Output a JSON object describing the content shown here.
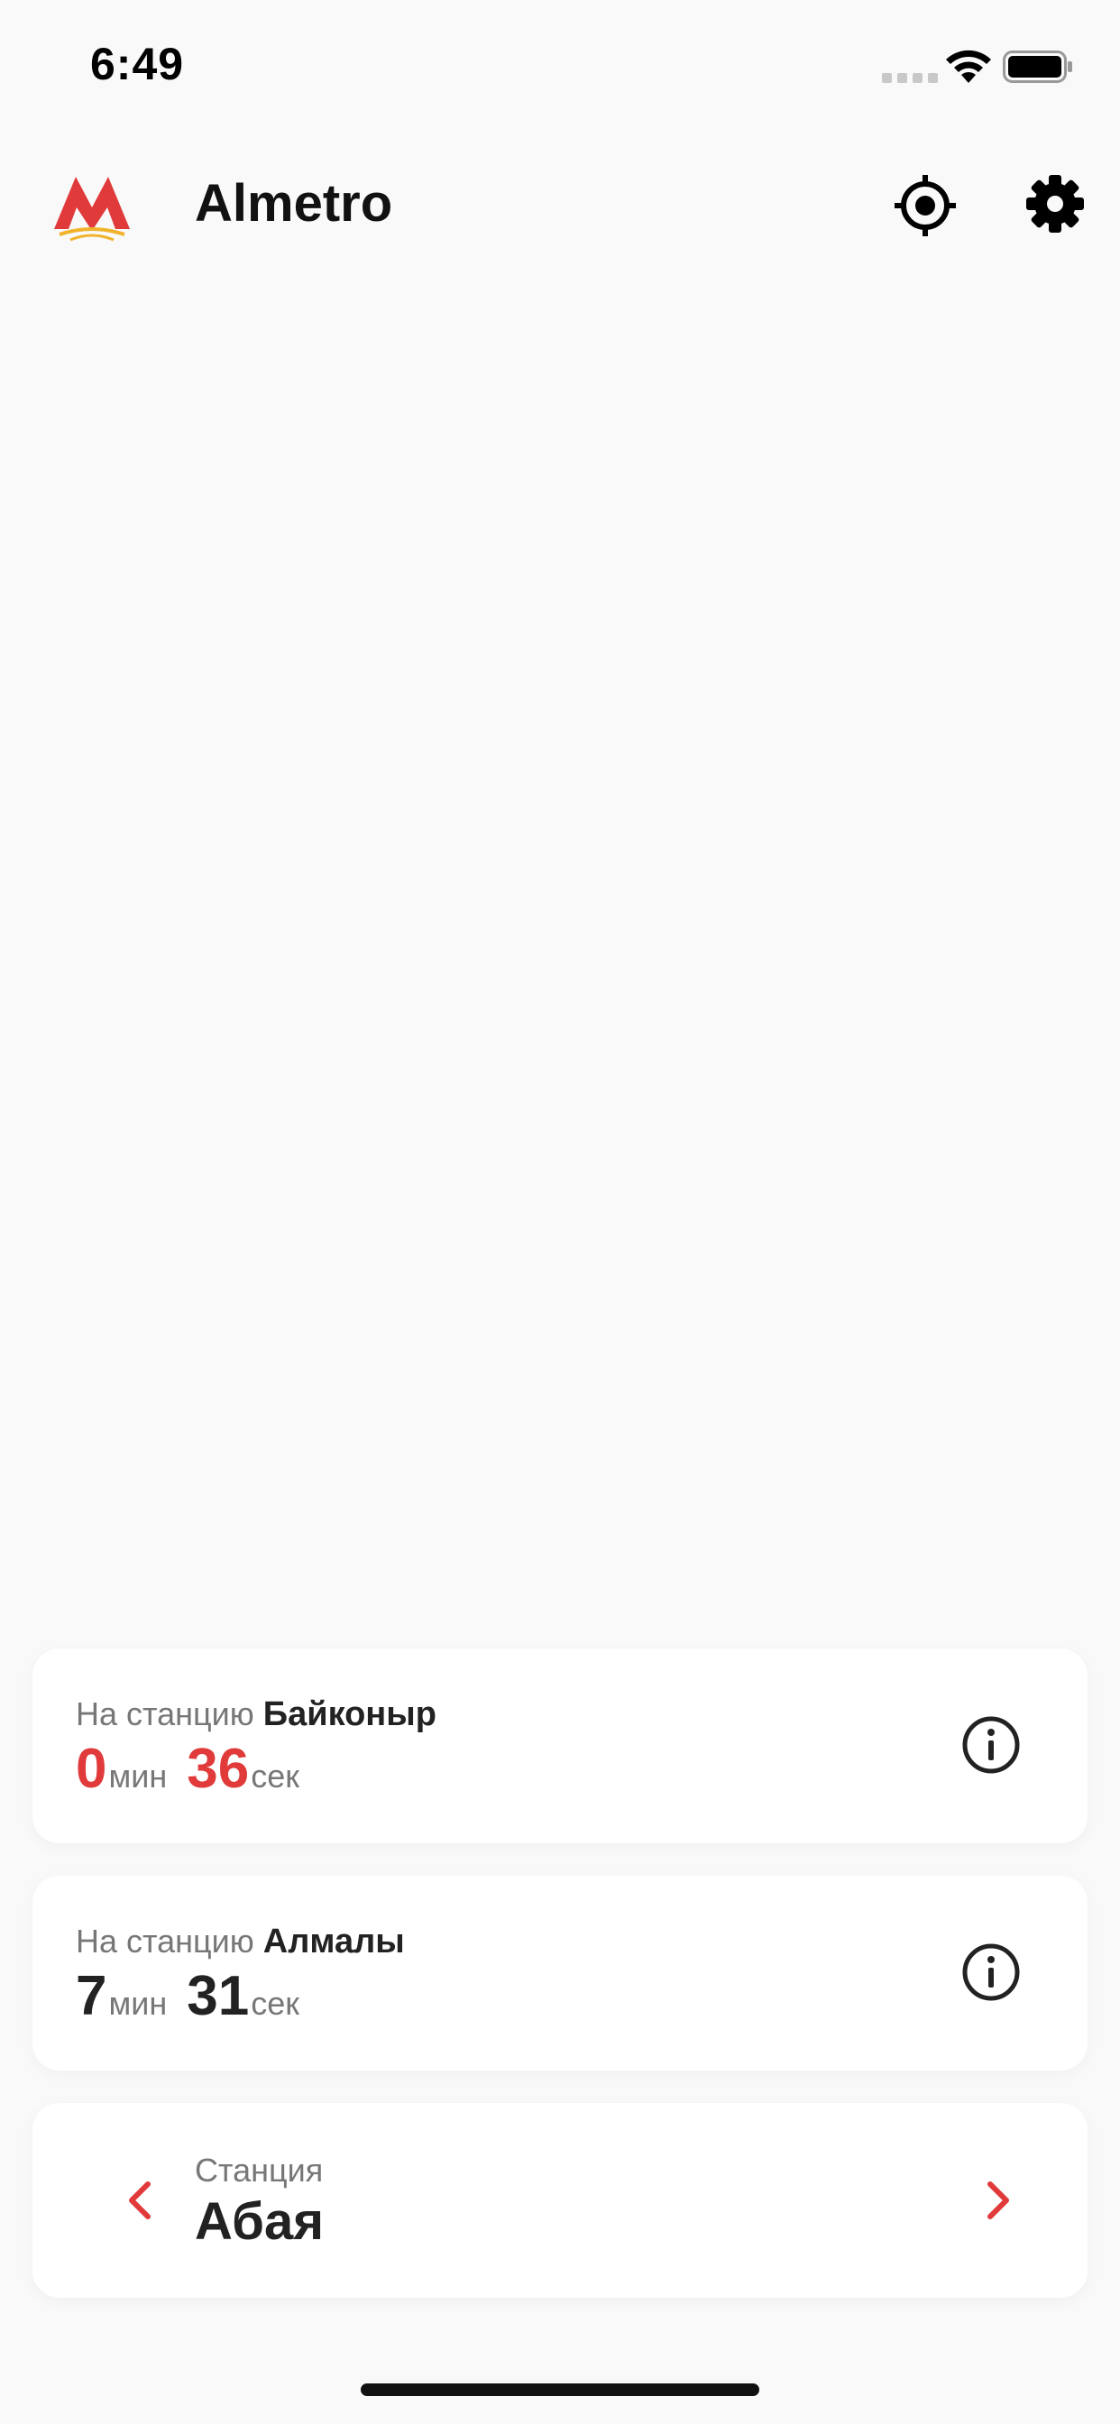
{
  "status_bar": {
    "time": "6:49",
    "icons": [
      "signal-dots-icon",
      "wifi-icon",
      "battery-icon"
    ]
  },
  "header": {
    "app_title": "Almetro",
    "logo": "metro-logo-icon",
    "actions": [
      "locate-icon",
      "gear-icon"
    ]
  },
  "arrivals": [
    {
      "prefix": "На станцию",
      "station": "Байконыр",
      "minutes": "0",
      "minutes_unit": "мин",
      "seconds": "36",
      "seconds_unit": "сек",
      "highlight": true
    },
    {
      "prefix": "На станцию",
      "station": "Алмалы",
      "minutes": "7",
      "minutes_unit": "мин",
      "seconds": "31",
      "seconds_unit": "сек",
      "highlight": false
    }
  ],
  "station_selector": {
    "caption": "Станция",
    "current": "Абая"
  },
  "colors": {
    "accent": "#e03a3a",
    "background": "#f9f9f9",
    "card": "#ffffff",
    "muted_text": "#777777"
  }
}
